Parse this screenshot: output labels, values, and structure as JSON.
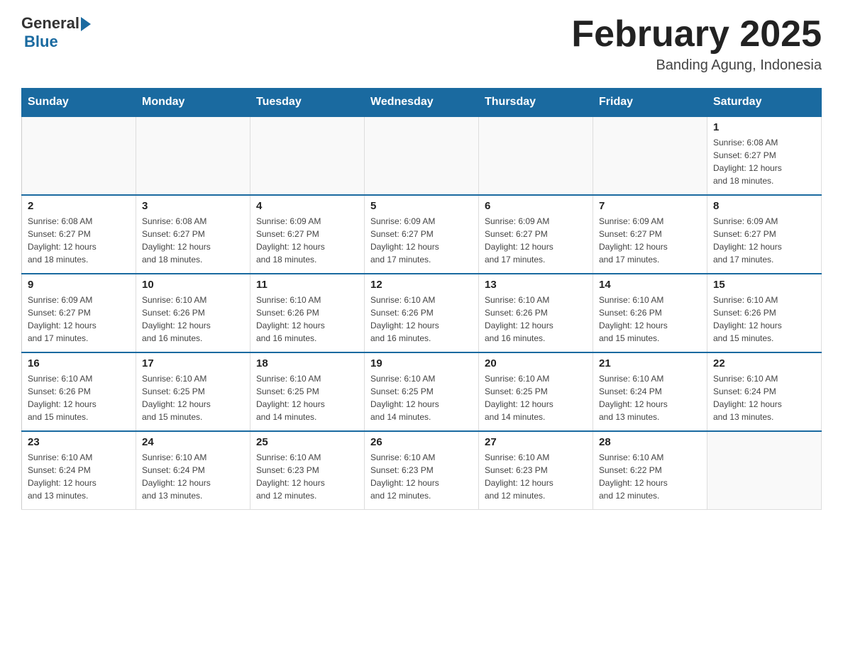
{
  "header": {
    "logo_general": "General",
    "logo_blue": "Blue",
    "month_title": "February 2025",
    "location": "Banding Agung, Indonesia"
  },
  "days_of_week": [
    "Sunday",
    "Monday",
    "Tuesday",
    "Wednesday",
    "Thursday",
    "Friday",
    "Saturday"
  ],
  "weeks": [
    {
      "days": [
        {
          "number": "",
          "info": ""
        },
        {
          "number": "",
          "info": ""
        },
        {
          "number": "",
          "info": ""
        },
        {
          "number": "",
          "info": ""
        },
        {
          "number": "",
          "info": ""
        },
        {
          "number": "",
          "info": ""
        },
        {
          "number": "1",
          "info": "Sunrise: 6:08 AM\nSunset: 6:27 PM\nDaylight: 12 hours\nand 18 minutes."
        }
      ]
    },
    {
      "days": [
        {
          "number": "2",
          "info": "Sunrise: 6:08 AM\nSunset: 6:27 PM\nDaylight: 12 hours\nand 18 minutes."
        },
        {
          "number": "3",
          "info": "Sunrise: 6:08 AM\nSunset: 6:27 PM\nDaylight: 12 hours\nand 18 minutes."
        },
        {
          "number": "4",
          "info": "Sunrise: 6:09 AM\nSunset: 6:27 PM\nDaylight: 12 hours\nand 18 minutes."
        },
        {
          "number": "5",
          "info": "Sunrise: 6:09 AM\nSunset: 6:27 PM\nDaylight: 12 hours\nand 17 minutes."
        },
        {
          "number": "6",
          "info": "Sunrise: 6:09 AM\nSunset: 6:27 PM\nDaylight: 12 hours\nand 17 minutes."
        },
        {
          "number": "7",
          "info": "Sunrise: 6:09 AM\nSunset: 6:27 PM\nDaylight: 12 hours\nand 17 minutes."
        },
        {
          "number": "8",
          "info": "Sunrise: 6:09 AM\nSunset: 6:27 PM\nDaylight: 12 hours\nand 17 minutes."
        }
      ]
    },
    {
      "days": [
        {
          "number": "9",
          "info": "Sunrise: 6:09 AM\nSunset: 6:27 PM\nDaylight: 12 hours\nand 17 minutes."
        },
        {
          "number": "10",
          "info": "Sunrise: 6:10 AM\nSunset: 6:26 PM\nDaylight: 12 hours\nand 16 minutes."
        },
        {
          "number": "11",
          "info": "Sunrise: 6:10 AM\nSunset: 6:26 PM\nDaylight: 12 hours\nand 16 minutes."
        },
        {
          "number": "12",
          "info": "Sunrise: 6:10 AM\nSunset: 6:26 PM\nDaylight: 12 hours\nand 16 minutes."
        },
        {
          "number": "13",
          "info": "Sunrise: 6:10 AM\nSunset: 6:26 PM\nDaylight: 12 hours\nand 16 minutes."
        },
        {
          "number": "14",
          "info": "Sunrise: 6:10 AM\nSunset: 6:26 PM\nDaylight: 12 hours\nand 15 minutes."
        },
        {
          "number": "15",
          "info": "Sunrise: 6:10 AM\nSunset: 6:26 PM\nDaylight: 12 hours\nand 15 minutes."
        }
      ]
    },
    {
      "days": [
        {
          "number": "16",
          "info": "Sunrise: 6:10 AM\nSunset: 6:26 PM\nDaylight: 12 hours\nand 15 minutes."
        },
        {
          "number": "17",
          "info": "Sunrise: 6:10 AM\nSunset: 6:25 PM\nDaylight: 12 hours\nand 15 minutes."
        },
        {
          "number": "18",
          "info": "Sunrise: 6:10 AM\nSunset: 6:25 PM\nDaylight: 12 hours\nand 14 minutes."
        },
        {
          "number": "19",
          "info": "Sunrise: 6:10 AM\nSunset: 6:25 PM\nDaylight: 12 hours\nand 14 minutes."
        },
        {
          "number": "20",
          "info": "Sunrise: 6:10 AM\nSunset: 6:25 PM\nDaylight: 12 hours\nand 14 minutes."
        },
        {
          "number": "21",
          "info": "Sunrise: 6:10 AM\nSunset: 6:24 PM\nDaylight: 12 hours\nand 13 minutes."
        },
        {
          "number": "22",
          "info": "Sunrise: 6:10 AM\nSunset: 6:24 PM\nDaylight: 12 hours\nand 13 minutes."
        }
      ]
    },
    {
      "days": [
        {
          "number": "23",
          "info": "Sunrise: 6:10 AM\nSunset: 6:24 PM\nDaylight: 12 hours\nand 13 minutes."
        },
        {
          "number": "24",
          "info": "Sunrise: 6:10 AM\nSunset: 6:24 PM\nDaylight: 12 hours\nand 13 minutes."
        },
        {
          "number": "25",
          "info": "Sunrise: 6:10 AM\nSunset: 6:23 PM\nDaylight: 12 hours\nand 12 minutes."
        },
        {
          "number": "26",
          "info": "Sunrise: 6:10 AM\nSunset: 6:23 PM\nDaylight: 12 hours\nand 12 minutes."
        },
        {
          "number": "27",
          "info": "Sunrise: 6:10 AM\nSunset: 6:23 PM\nDaylight: 12 hours\nand 12 minutes."
        },
        {
          "number": "28",
          "info": "Sunrise: 6:10 AM\nSunset: 6:22 PM\nDaylight: 12 hours\nand 12 minutes."
        },
        {
          "number": "",
          "info": ""
        }
      ]
    }
  ]
}
